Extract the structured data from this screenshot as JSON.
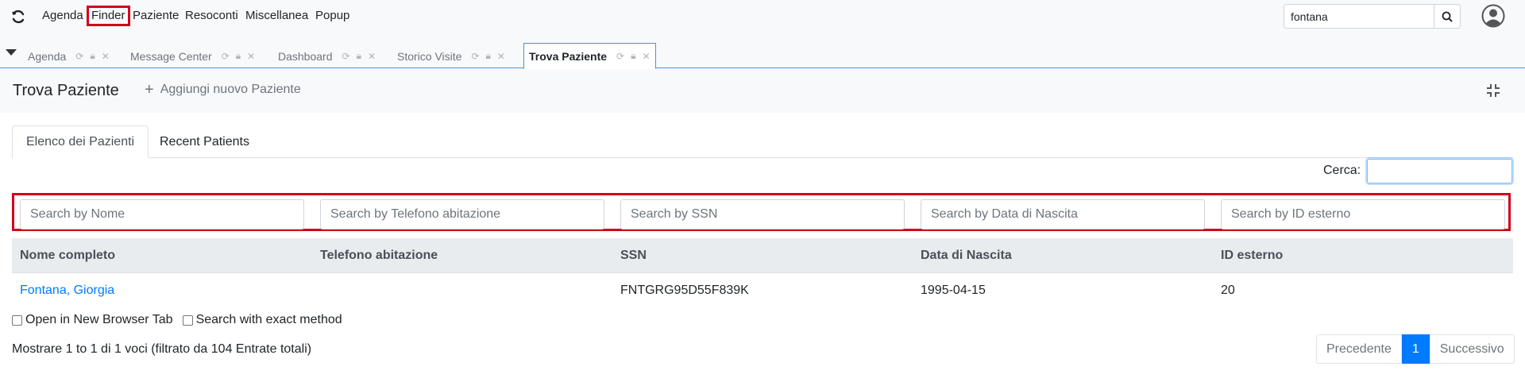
{
  "navbar": {
    "menu": [
      {
        "label": "Agenda"
      },
      {
        "label": "Finder"
      },
      {
        "label": "Paziente"
      },
      {
        "label": "Resoconti"
      },
      {
        "label": "Miscellanea"
      },
      {
        "label": "Popup"
      }
    ],
    "search_value": "fontana",
    "highlight_color": "#d0021b"
  },
  "tabs": [
    {
      "label": "Agenda"
    },
    {
      "label": "Message Center"
    },
    {
      "label": "Dashboard"
    },
    {
      "label": "Storico Visite"
    },
    {
      "label": "Trova Paziente"
    }
  ],
  "page": {
    "title": "Trova Paziente",
    "add_label": "Aggiungi nuovo Paziente"
  },
  "content_tabs": [
    {
      "label": "Elenco dei Pazienti"
    },
    {
      "label": "Recent Patients"
    }
  ],
  "cerca_label": "Cerca:",
  "filters": [
    {
      "placeholder": "Search by Nome"
    },
    {
      "placeholder": "Search by Telefono abitazione"
    },
    {
      "placeholder": "Search by SSN"
    },
    {
      "placeholder": "Search by Data di Nascita"
    },
    {
      "placeholder": "Search by ID esterno"
    }
  ],
  "table": {
    "headers": [
      "Nome completo",
      "Telefono abitazione",
      "SSN",
      "Data di Nascita",
      "ID esterno"
    ],
    "rows": [
      {
        "name": "Fontana, Giorgia",
        "phone": "",
        "ssn": "FNTGRG95D55F839K",
        "dob": "1995-04-15",
        "external_id": "20"
      }
    ]
  },
  "options": {
    "new_tab": "Open in New Browser Tab",
    "exact": "Search with exact method"
  },
  "info": "Mostrare 1 to 1 di 1 voci (filtrato da 104 Entrate totali)",
  "pagination": {
    "prev": "Precedente",
    "current": "1",
    "next": "Successivo"
  },
  "colors": {
    "link": "#007bff",
    "accent": "#4a90d9"
  }
}
